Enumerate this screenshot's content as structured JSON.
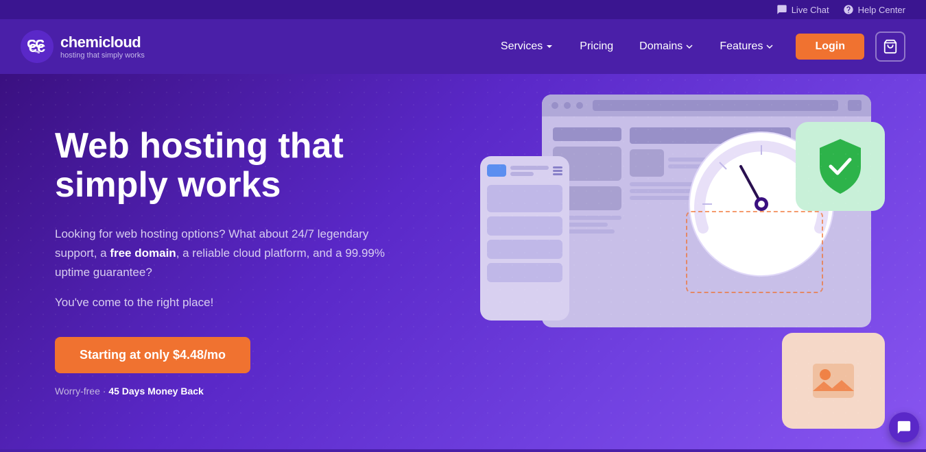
{
  "topbar": {
    "live_chat": "Live Chat",
    "help_center": "Help Center"
  },
  "nav": {
    "logo_name": "chemicloud",
    "logo_tagline": "hosting that simply works",
    "services_label": "Services",
    "pricing_label": "Pricing",
    "domains_label": "Domains",
    "features_label": "Features",
    "login_label": "Login"
  },
  "hero": {
    "title": "Web hosting that simply works",
    "desc_part1": "Looking for web hosting options? What about 24/7 legendary support, a ",
    "desc_bold": "free domain",
    "desc_part2": ", a reliable cloud platform, and a 99.99% uptime guarantee?",
    "desc2": "You've come to the right place!",
    "cta_label": "Starting at only $4.48/mo",
    "money_back_prefix": "Worry-free · ",
    "money_back_bold": "45 Days Money Back"
  },
  "colors": {
    "primary": "#5a28c8",
    "orange": "#f07230",
    "dark_purple": "#3a1080",
    "shield_green": "#2db34a"
  }
}
